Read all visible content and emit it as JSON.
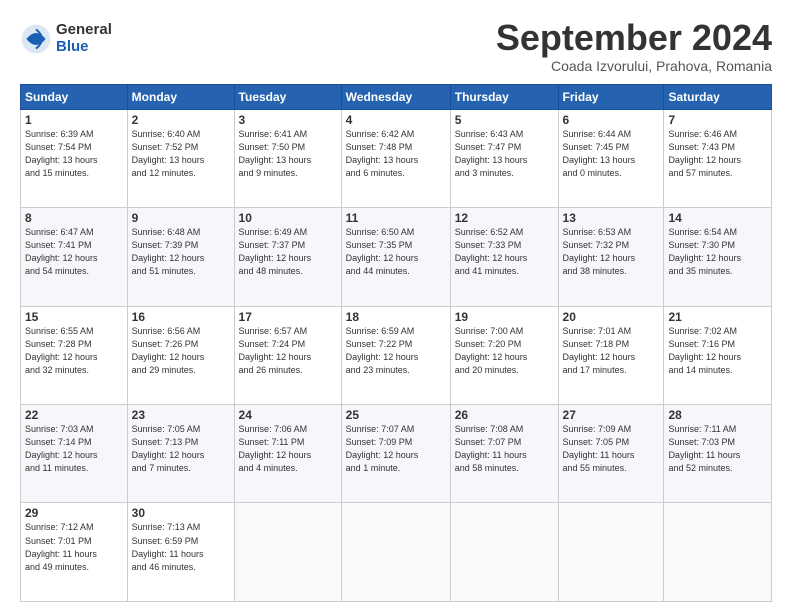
{
  "logo": {
    "general": "General",
    "blue": "Blue"
  },
  "header": {
    "month": "September 2024",
    "location": "Coada Izvorului, Prahova, Romania"
  },
  "weekdays": [
    "Sunday",
    "Monday",
    "Tuesday",
    "Wednesday",
    "Thursday",
    "Friday",
    "Saturday"
  ],
  "weeks": [
    [
      {
        "day": "1",
        "info": "Sunrise: 6:39 AM\nSunset: 7:54 PM\nDaylight: 13 hours\nand 15 minutes."
      },
      {
        "day": "2",
        "info": "Sunrise: 6:40 AM\nSunset: 7:52 PM\nDaylight: 13 hours\nand 12 minutes."
      },
      {
        "day": "3",
        "info": "Sunrise: 6:41 AM\nSunset: 7:50 PM\nDaylight: 13 hours\nand 9 minutes."
      },
      {
        "day": "4",
        "info": "Sunrise: 6:42 AM\nSunset: 7:48 PM\nDaylight: 13 hours\nand 6 minutes."
      },
      {
        "day": "5",
        "info": "Sunrise: 6:43 AM\nSunset: 7:47 PM\nDaylight: 13 hours\nand 3 minutes."
      },
      {
        "day": "6",
        "info": "Sunrise: 6:44 AM\nSunset: 7:45 PM\nDaylight: 13 hours\nand 0 minutes."
      },
      {
        "day": "7",
        "info": "Sunrise: 6:46 AM\nSunset: 7:43 PM\nDaylight: 12 hours\nand 57 minutes."
      }
    ],
    [
      {
        "day": "8",
        "info": "Sunrise: 6:47 AM\nSunset: 7:41 PM\nDaylight: 12 hours\nand 54 minutes."
      },
      {
        "day": "9",
        "info": "Sunrise: 6:48 AM\nSunset: 7:39 PM\nDaylight: 12 hours\nand 51 minutes."
      },
      {
        "day": "10",
        "info": "Sunrise: 6:49 AM\nSunset: 7:37 PM\nDaylight: 12 hours\nand 48 minutes."
      },
      {
        "day": "11",
        "info": "Sunrise: 6:50 AM\nSunset: 7:35 PM\nDaylight: 12 hours\nand 44 minutes."
      },
      {
        "day": "12",
        "info": "Sunrise: 6:52 AM\nSunset: 7:33 PM\nDaylight: 12 hours\nand 41 minutes."
      },
      {
        "day": "13",
        "info": "Sunrise: 6:53 AM\nSunset: 7:32 PM\nDaylight: 12 hours\nand 38 minutes."
      },
      {
        "day": "14",
        "info": "Sunrise: 6:54 AM\nSunset: 7:30 PM\nDaylight: 12 hours\nand 35 minutes."
      }
    ],
    [
      {
        "day": "15",
        "info": "Sunrise: 6:55 AM\nSunset: 7:28 PM\nDaylight: 12 hours\nand 32 minutes."
      },
      {
        "day": "16",
        "info": "Sunrise: 6:56 AM\nSunset: 7:26 PM\nDaylight: 12 hours\nand 29 minutes."
      },
      {
        "day": "17",
        "info": "Sunrise: 6:57 AM\nSunset: 7:24 PM\nDaylight: 12 hours\nand 26 minutes."
      },
      {
        "day": "18",
        "info": "Sunrise: 6:59 AM\nSunset: 7:22 PM\nDaylight: 12 hours\nand 23 minutes."
      },
      {
        "day": "19",
        "info": "Sunrise: 7:00 AM\nSunset: 7:20 PM\nDaylight: 12 hours\nand 20 minutes."
      },
      {
        "day": "20",
        "info": "Sunrise: 7:01 AM\nSunset: 7:18 PM\nDaylight: 12 hours\nand 17 minutes."
      },
      {
        "day": "21",
        "info": "Sunrise: 7:02 AM\nSunset: 7:16 PM\nDaylight: 12 hours\nand 14 minutes."
      }
    ],
    [
      {
        "day": "22",
        "info": "Sunrise: 7:03 AM\nSunset: 7:14 PM\nDaylight: 12 hours\nand 11 minutes."
      },
      {
        "day": "23",
        "info": "Sunrise: 7:05 AM\nSunset: 7:13 PM\nDaylight: 12 hours\nand 7 minutes."
      },
      {
        "day": "24",
        "info": "Sunrise: 7:06 AM\nSunset: 7:11 PM\nDaylight: 12 hours\nand 4 minutes."
      },
      {
        "day": "25",
        "info": "Sunrise: 7:07 AM\nSunset: 7:09 PM\nDaylight: 12 hours\nand 1 minute."
      },
      {
        "day": "26",
        "info": "Sunrise: 7:08 AM\nSunset: 7:07 PM\nDaylight: 11 hours\nand 58 minutes."
      },
      {
        "day": "27",
        "info": "Sunrise: 7:09 AM\nSunset: 7:05 PM\nDaylight: 11 hours\nand 55 minutes."
      },
      {
        "day": "28",
        "info": "Sunrise: 7:11 AM\nSunset: 7:03 PM\nDaylight: 11 hours\nand 52 minutes."
      }
    ],
    [
      {
        "day": "29",
        "info": "Sunrise: 7:12 AM\nSunset: 7:01 PM\nDaylight: 11 hours\nand 49 minutes."
      },
      {
        "day": "30",
        "info": "Sunrise: 7:13 AM\nSunset: 6:59 PM\nDaylight: 11 hours\nand 46 minutes."
      },
      {
        "day": "",
        "info": ""
      },
      {
        "day": "",
        "info": ""
      },
      {
        "day": "",
        "info": ""
      },
      {
        "day": "",
        "info": ""
      },
      {
        "day": "",
        "info": ""
      }
    ]
  ]
}
